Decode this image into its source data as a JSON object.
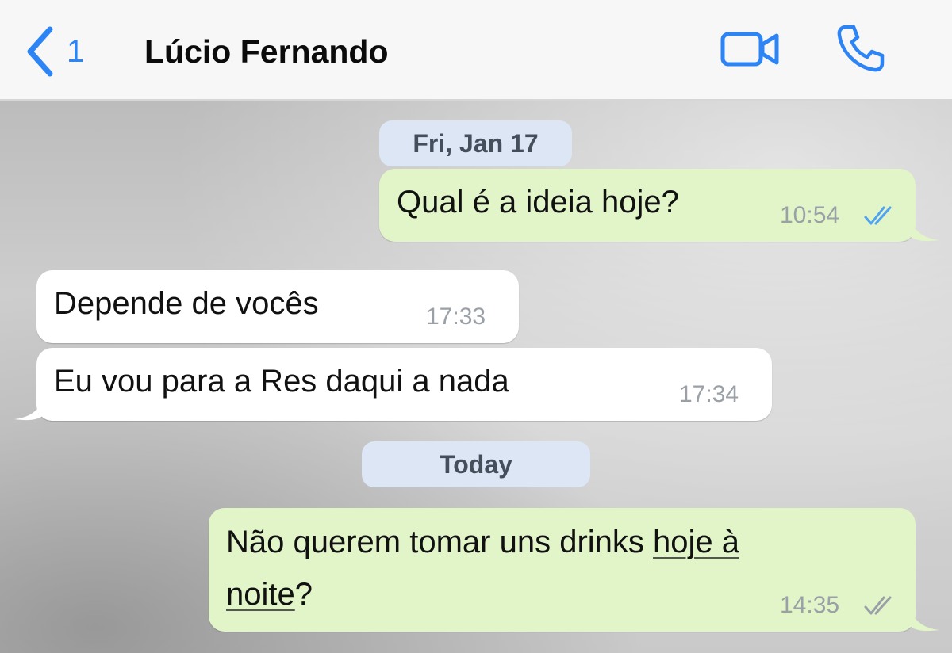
{
  "header": {
    "back_count": "1",
    "contact_name": "Lúcio Fernando",
    "icons": {
      "back": "chevron-left-icon",
      "video": "video-camera-icon",
      "call": "phone-icon"
    },
    "accent_color": "#2d84f5"
  },
  "chat": {
    "date_separators": [
      "Fri, Jan 17",
      "Today"
    ],
    "messages": [
      {
        "direction": "outgoing",
        "text": "Qual é a ideia hoje?",
        "time": "10:54",
        "status": "read"
      },
      {
        "direction": "incoming",
        "text": "Depende de vocês",
        "time": "17:33"
      },
      {
        "direction": "incoming",
        "text": "Eu vou para a Res daqui a nada",
        "time": "17:34"
      },
      {
        "direction": "outgoing",
        "text_part1": "Não querem tomar uns drinks ",
        "text_link1": "hoje à",
        "text_link2": "noite",
        "text_part2": "?",
        "time": "14:35",
        "status": "delivered"
      }
    ],
    "colors": {
      "outgoing_bubble": "#e1f5c9",
      "incoming_bubble": "#ffffff",
      "date_pill": "#dde6f5",
      "read_ticks": "#4fa3f0",
      "delivered_ticks": "#9aa0a6"
    }
  }
}
